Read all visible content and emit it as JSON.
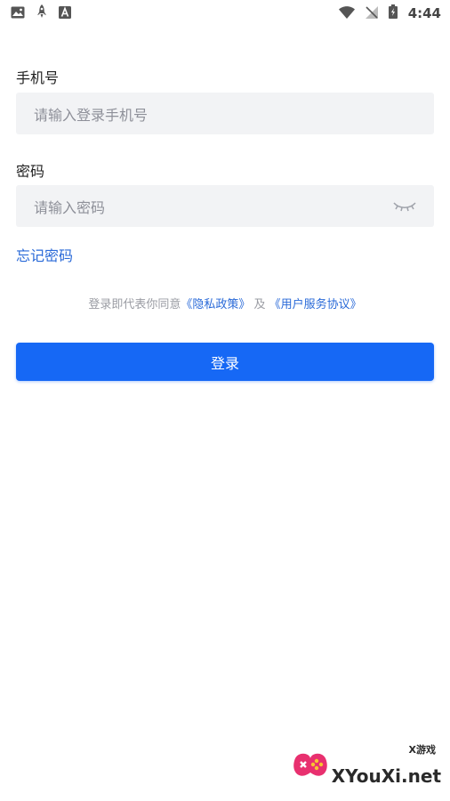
{
  "status_bar": {
    "time": "4:44",
    "left_icons": [
      "image-icon",
      "rocket-icon",
      "font-icon"
    ],
    "right_icons": [
      "wifi-icon",
      "no-signal-icon",
      "battery-charging-icon"
    ]
  },
  "phone_field": {
    "label": "手机号",
    "placeholder": "请输入登录手机号"
  },
  "password_field": {
    "label": "密码",
    "placeholder": "请输入密码",
    "toggle_icon": "eye-closed-icon"
  },
  "forgot_password": "忘记密码",
  "agreement": {
    "prefix": "登录即代表你同意",
    "privacy_link": "《隐私政策》",
    "conjunction": "及",
    "terms_link": "《用户服务协议》"
  },
  "login_button": "登录",
  "watermark": {
    "brand": "XYouXi.net",
    "tag": "X游戏"
  },
  "colors": {
    "primary": "#1668f5",
    "link": "#2a6ad8",
    "input_bg": "#f2f3f5"
  }
}
